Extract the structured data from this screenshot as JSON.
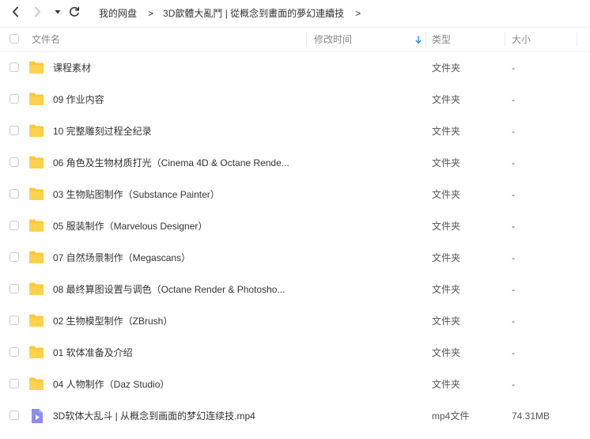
{
  "nav": {
    "back_icon": "chevron-left-icon",
    "forward_icon": "chevron-right-icon",
    "history_icon": "caret-down-icon",
    "refresh_icon": "refresh-icon"
  },
  "breadcrumb": {
    "items": [
      {
        "label": "我的网盘"
      },
      {
        "label": "3D歆體大亂鬥 | 從概念到畫面的夢幻連續技"
      }
    ],
    "separator": ">"
  },
  "columns": {
    "name": "文件名",
    "modified": "修改时间",
    "type": "类型",
    "size": "大小"
  },
  "files": [
    {
      "name": "课程素材",
      "type": "文件夹",
      "size": "-",
      "icon": "folder-icon"
    },
    {
      "name": "09 作业内容",
      "type": "文件夹",
      "size": "-",
      "icon": "folder-icon"
    },
    {
      "name": "10 完整雕刻过程全纪录",
      "type": "文件夹",
      "size": "-",
      "icon": "folder-icon"
    },
    {
      "name": "06 角色及生物材质打光（Cinema 4D & Octane Rende...",
      "type": "文件夹",
      "size": "-",
      "icon": "folder-icon"
    },
    {
      "name": "03 生物贴图制作（Substance Painter）",
      "type": "文件夹",
      "size": "-",
      "icon": "folder-icon"
    },
    {
      "name": "05 服装制作（Marvelous Designer）",
      "type": "文件夹",
      "size": "-",
      "icon": "folder-icon"
    },
    {
      "name": "07 自然场景制作（Megascans）",
      "type": "文件夹",
      "size": "-",
      "icon": "folder-icon"
    },
    {
      "name": "08 最终算图设置与调色（Octane Render & Photosho...",
      "type": "文件夹",
      "size": "-",
      "icon": "folder-icon"
    },
    {
      "name": "02 生物模型制作（ZBrush）",
      "type": "文件夹",
      "size": "-",
      "icon": "folder-icon"
    },
    {
      "name": "01 软体准备及介绍",
      "type": "文件夹",
      "size": "-",
      "icon": "folder-icon"
    },
    {
      "name": "04 人物制作（Daz Studio）",
      "type": "文件夹",
      "size": "-",
      "icon": "folder-icon"
    },
    {
      "name": "3D软体大乱斗 | 从概念到画面的梦幻连续技.mp4",
      "type": "mp4文件",
      "size": "74.31MB",
      "icon": "video-file-icon"
    }
  ],
  "colors": {
    "folder": "#FFC73B",
    "video": "#8E8CF0",
    "sort_accent": "#2F8FE8"
  }
}
